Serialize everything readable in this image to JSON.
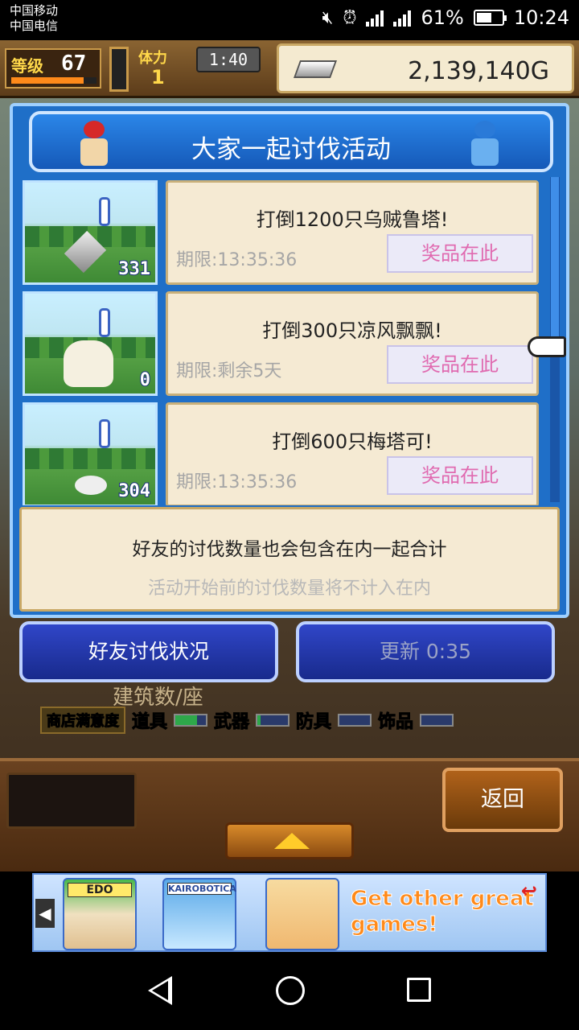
{
  "status_bar": {
    "carrier_1": "中国移动",
    "carrier_2": "中国电信",
    "battery": "61%",
    "time": "10:24",
    "battery_level": 0.61
  },
  "hud": {
    "level_label": "等级",
    "level": "67",
    "stamina_label": "体力",
    "stamina": "1",
    "timer": "1:40",
    "gold": "2,139,140G"
  },
  "dialog": {
    "title": "大家一起讨伐活动",
    "events": [
      {
        "title": "打倒1200只乌贼鲁塔!",
        "deadline": "期限:13:35:36",
        "prize_label": "奖品在此",
        "count": "331",
        "monster_icon": "sword-monster-icon"
      },
      {
        "title": "打倒300只凉风飘飘!",
        "deadline": "期限:剩余5天",
        "prize_label": "奖品在此",
        "count": "0",
        "monster_icon": "ghost-monster-icon"
      },
      {
        "title": "打倒600只梅塔可!",
        "deadline": "期限:13:35:36",
        "prize_label": "奖品在此",
        "count": "304",
        "monster_icon": "blob-monster-icon"
      }
    ],
    "note_main": "好友的讨伐数量也会包含在内一起合计",
    "note_sub": "活动开始前的讨伐数量将不计入在内"
  },
  "buttons": {
    "friend_status": "好友讨伐状况",
    "refresh": "更新 0:35",
    "back": "返回"
  },
  "lower_panel": {
    "buildings_label": "建筑数/座",
    "shop_satisfaction": "商店满意度",
    "tags": [
      "道具",
      "武器",
      "防具",
      "饰品"
    ]
  },
  "ad": {
    "tile_1": "EDO",
    "tile_2": "KAIROBOTICA",
    "text": "Get other great games!"
  },
  "colors": {
    "dialog_blue": "#1f6fc8",
    "card_bg": "#f5ead3",
    "prize_text": "#e06ab0"
  }
}
